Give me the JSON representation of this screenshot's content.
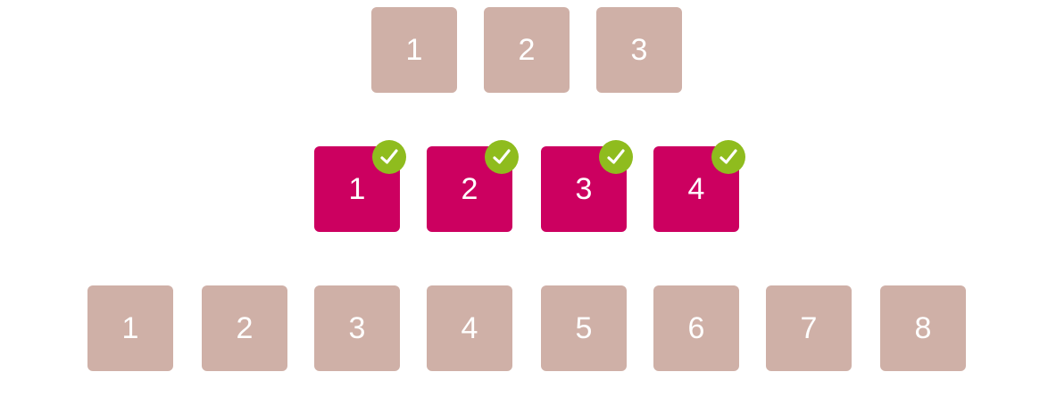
{
  "colors": {
    "tile_idle": "#cfb0a7",
    "tile_selected": "#cc0060",
    "check_badge": "#8fbc1e",
    "text": "#ffffff"
  },
  "rows": [
    {
      "state": "unselected",
      "tiles": [
        {
          "label": "1"
        },
        {
          "label": "2"
        },
        {
          "label": "3"
        }
      ]
    },
    {
      "state": "selected",
      "badge_icon": "checkmark-icon",
      "tiles": [
        {
          "label": "1"
        },
        {
          "label": "2"
        },
        {
          "label": "3"
        },
        {
          "label": "4"
        }
      ]
    },
    {
      "state": "unselected",
      "tiles": [
        {
          "label": "1"
        },
        {
          "label": "2"
        },
        {
          "label": "3"
        },
        {
          "label": "4"
        },
        {
          "label": "5"
        },
        {
          "label": "6"
        },
        {
          "label": "7"
        },
        {
          "label": "8"
        }
      ]
    }
  ]
}
